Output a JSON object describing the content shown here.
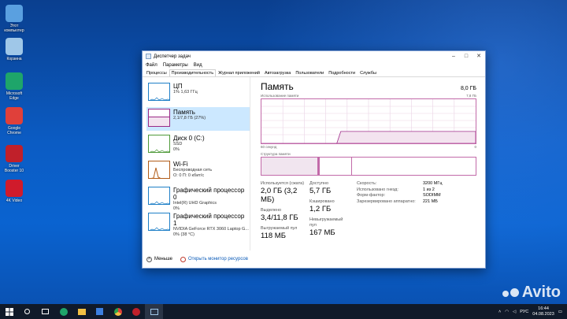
{
  "desktop": {
    "icons": [
      {
        "name": "Этот компьютер",
        "color": "#5aa0e0"
      },
      {
        "name": "Корзина",
        "color": "#9fc7e8"
      },
      {
        "name": "Microsoft Edge",
        "color": "#1ea56a"
      },
      {
        "name": "Google Chrome",
        "color": "#e0403a"
      },
      {
        "name": "Driver Booster 10",
        "color": "#c0202a"
      },
      {
        "name": "4K Video",
        "color": "#d01b2b"
      }
    ]
  },
  "window": {
    "title": "Диспетчер задач",
    "menu": [
      "Файл",
      "Параметры",
      "Вид"
    ],
    "tabs": [
      "Процессы",
      "Производительность",
      "Журнал приложений",
      "Автозагрузка",
      "Пользователи",
      "Подробности",
      "Службы"
    ],
    "active_tab": "Производительность",
    "controls": [
      "–",
      "□",
      "✕"
    ]
  },
  "sidebar": [
    {
      "title": "ЦП",
      "lines": [
        "1% 1,63 ГГц"
      ],
      "color": "#1e7fc7"
    },
    {
      "title": "Память",
      "lines": [
        "2,1/7,8 ГБ (27%)"
      ],
      "color": "#9a2a86"
    },
    {
      "title": "Диск 0 (C:)",
      "lines": [
        "SSD",
        "0%"
      ],
      "color": "#4f9a3a"
    },
    {
      "title": "Wi-Fi",
      "lines": [
        "Беспроводная сеть",
        "О: 0  П: 0 кбит/с"
      ],
      "color": "#b25c18"
    },
    {
      "title": "Графический процессор 0",
      "lines": [
        "Intel(R) UHD Graphics",
        "0%"
      ],
      "color": "#1e7fc7"
    },
    {
      "title": "Графический процессор 1",
      "lines": [
        "NVIDIA GeForce RTX 3060 Laptop G...",
        "0% (38 °C)"
      ],
      "color": "#1e7fc7"
    }
  ],
  "memory": {
    "title": "Память",
    "total": "8,0 ГБ",
    "usage_label": "Использование памяти",
    "usage_max": "7,8 ГБ",
    "time_label": "60 секунд",
    "zero": "0",
    "struct_label": "Структура памяти",
    "stats": [
      {
        "label": "Используется (сжата)",
        "value": "2,0 ГБ (3,2 МБ)"
      },
      {
        "label": "Доступно",
        "value": "5,7 ГБ"
      },
      {
        "label": "Выделено",
        "value": "3,4/11,8 ГБ"
      },
      {
        "label": "Кэшировано",
        "value": "1,2 ГБ"
      },
      {
        "label": "Выгружаемый пул",
        "value": "118 МБ"
      },
      {
        "label": "Невыгружаемый пул",
        "value": "167 МБ"
      }
    ],
    "props": [
      {
        "k": "Скорость:",
        "v": "3200 МГц"
      },
      {
        "k": "Использовано гнезд:",
        "v": "1 из 2"
      },
      {
        "k": "Форм-фактор:",
        "v": "SODIMM"
      },
      {
        "k": "Зарезервировано аппаратно:",
        "v": "221 МБ"
      }
    ],
    "usage_pct": 27
  },
  "footer": {
    "less": "Меньше",
    "monitor": "Открыть монитор ресурсов"
  },
  "taskbar": {
    "lang": "РУС",
    "time": "16:44",
    "date": "04.08.2023"
  },
  "watermark": "Avito"
}
